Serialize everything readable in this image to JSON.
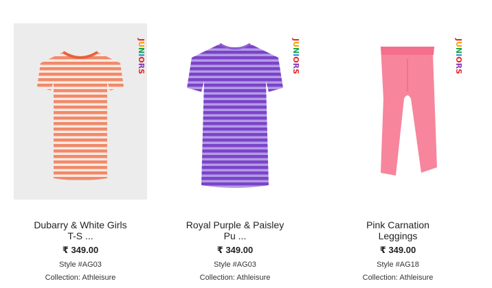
{
  "brand": {
    "tag": "JUNIORS",
    "colors": [
      "#e8252b",
      "#f5a100",
      "#1aa34a",
      "#1d8ad6",
      "#e8252b",
      "#8a3db6",
      "#e8252b"
    ]
  },
  "products": [
    {
      "title_line1": "Dubarry & White Girls",
      "title_line2": "T-S ...",
      "price": "₹ 349.00",
      "style": "Style #AG03",
      "collection": "Collection: Athleisure",
      "main_color": "#f08a6a",
      "stripe_color": "#fbe9e2"
    },
    {
      "title_line1": "Royal Purple & Paisley",
      "title_line2": "Pu ...",
      "price": "₹ 349.00",
      "style": "Style #AG03",
      "collection": "Collection: Athleisure",
      "main_color": "#7b44c8",
      "stripe_color": "#b49be6"
    },
    {
      "title_line1": "Pink Carnation",
      "title_line2": "Leggings",
      "price": "₹ 349.00",
      "style": "Style #AG18",
      "collection": "Collection: Athleisure",
      "main_color": "#f7859b"
    }
  ]
}
